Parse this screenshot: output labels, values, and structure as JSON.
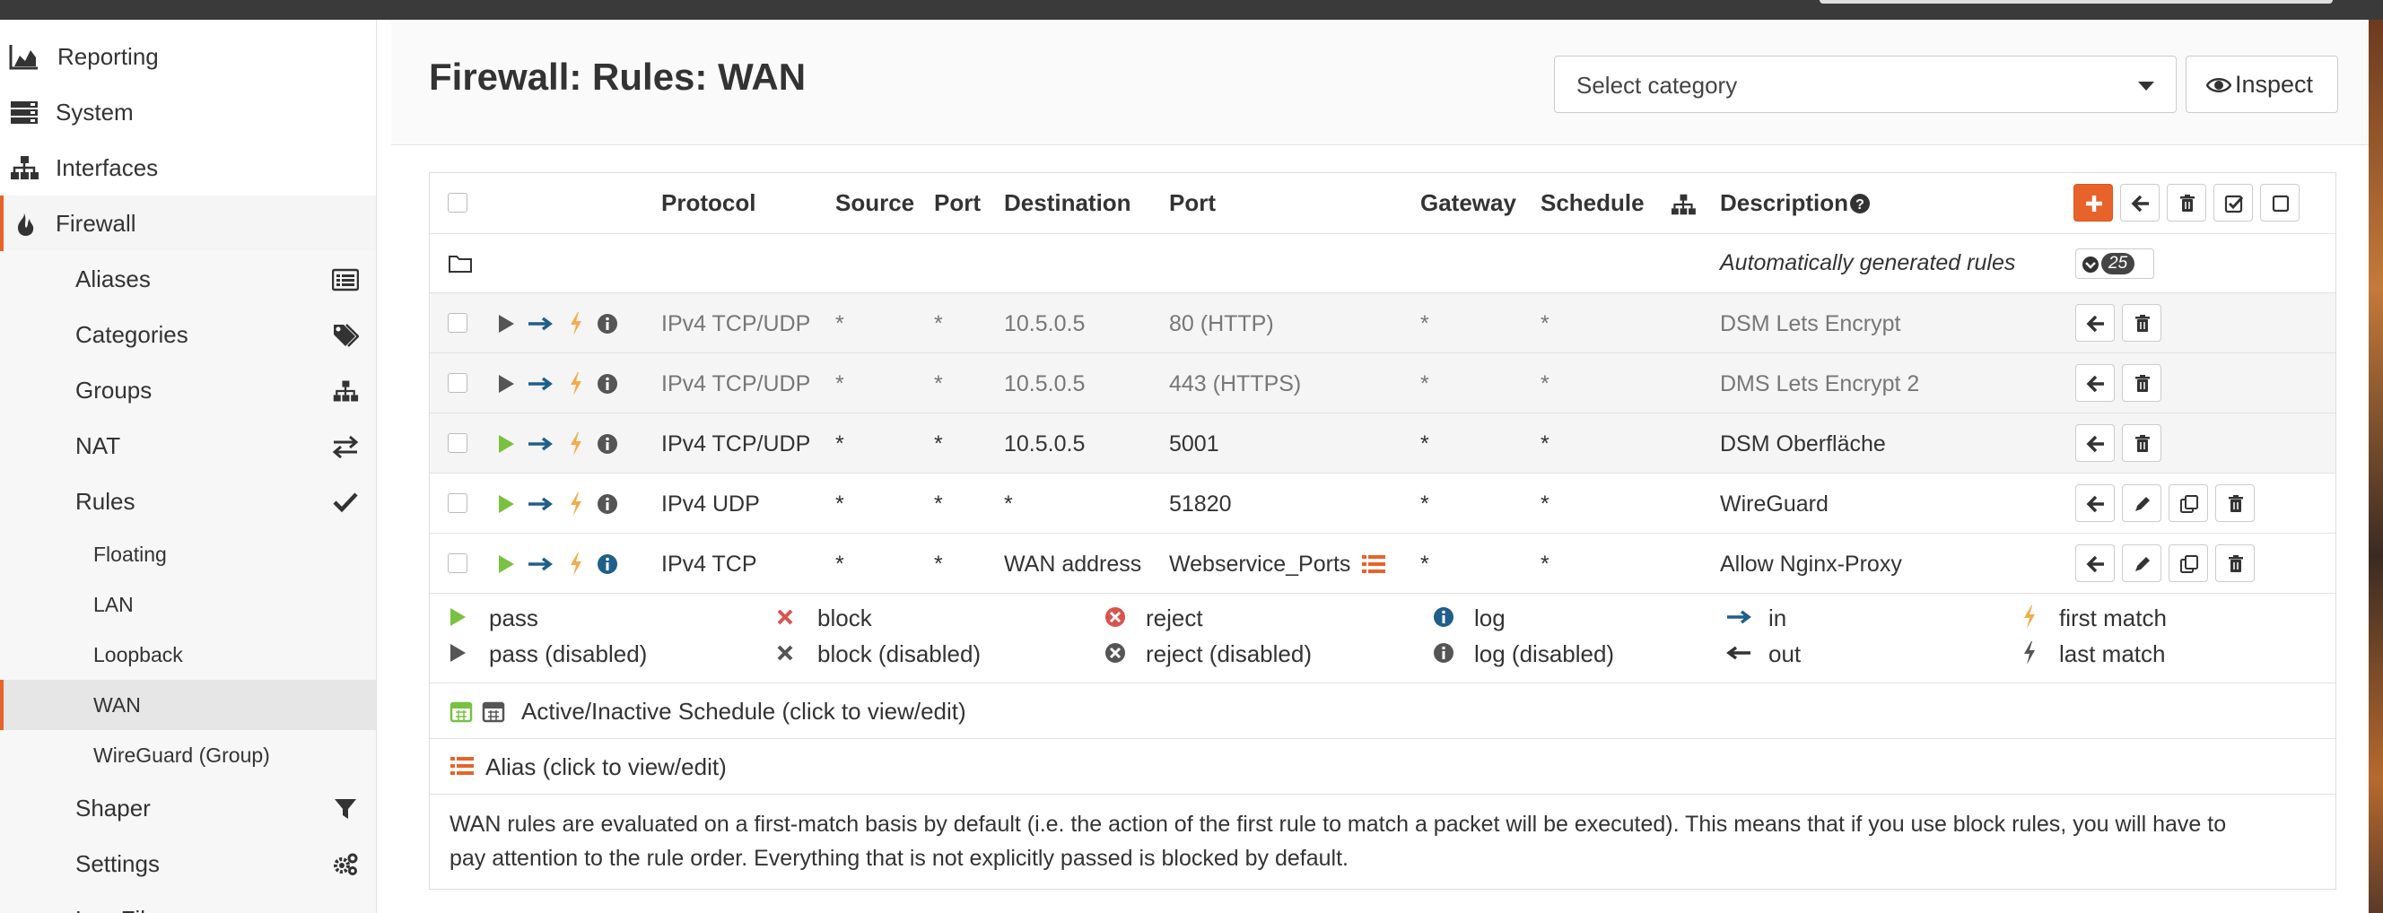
{
  "colors": {
    "accent": "#e8632a",
    "pass": "#7ac142",
    "block": "#d9534f",
    "info": "#1f5f8a",
    "arrow": "#1f5f8a",
    "bolt": "#f0ad4e"
  },
  "sidebar": {
    "items": [
      {
        "label": "Reporting",
        "icon": "chart-area-icon"
      },
      {
        "label": "System",
        "icon": "server-icon"
      },
      {
        "label": "Interfaces",
        "icon": "sitemap-icon"
      },
      {
        "label": "Firewall",
        "icon": "fire-icon"
      }
    ],
    "firewall_sub": [
      {
        "label": "Aliases",
        "icon": "list-alt-icon"
      },
      {
        "label": "Categories",
        "icon": "tags-icon"
      },
      {
        "label": "Groups",
        "icon": "sitemap-icon"
      },
      {
        "label": "NAT",
        "icon": "exchange-icon"
      },
      {
        "label": "Rules",
        "icon": "check-icon"
      }
    ],
    "rules_sub": [
      "Floating",
      "LAN",
      "Loopback",
      "WAN",
      "WireGuard (Group)"
    ],
    "after": [
      {
        "label": "Shaper",
        "icon": "filter-icon"
      },
      {
        "label": "Settings",
        "icon": "cogs-icon"
      }
    ],
    "cutoff_label": "Log Files"
  },
  "header": {
    "title": "Firewall: Rules: WAN",
    "category_select": "Select category",
    "inspect_label": "Inspect"
  },
  "table": {
    "columns": {
      "protocol": "Protocol",
      "source": "Source",
      "port": "Port",
      "destination": "Destination",
      "dport": "Port",
      "gateway": "Gateway",
      "schedule": "Schedule",
      "description": "Description"
    },
    "auto_rules": {
      "label": "Automatically generated rules",
      "count": "25"
    },
    "rows": [
      {
        "protocol": "IPv4 TCP/UDP",
        "source": "*",
        "port": "*",
        "destination": "10.5.0.5",
        "dport": "80 (HTTP)",
        "gateway": "*",
        "schedule": "*",
        "description": "DSM Lets Encrypt",
        "enabled": false
      },
      {
        "protocol": "IPv4 TCP/UDP",
        "source": "*",
        "port": "*",
        "destination": "10.5.0.5",
        "dport": "443 (HTTPS)",
        "gateway": "*",
        "schedule": "*",
        "description": "DMS Lets Encrypt 2",
        "enabled": false
      },
      {
        "protocol": "IPv4 TCP/UDP",
        "source": "*",
        "port": "*",
        "destination": "10.5.0.5",
        "dport": "5001",
        "gateway": "*",
        "schedule": "*",
        "description": "DSM Oberfläche",
        "enabled": true
      },
      {
        "protocol": "IPv4 UDP",
        "source": "*",
        "port": "*",
        "destination": "*",
        "dport": "51820",
        "gateway": "*",
        "schedule": "*",
        "description": "WireGuard",
        "enabled": true
      },
      {
        "protocol": "IPv4 TCP",
        "source": "*",
        "port": "*",
        "destination": "WAN address",
        "dport": "Webservice_Ports",
        "gateway": "*",
        "schedule": "*",
        "description": "Allow Nginx-Proxy",
        "enabled": true
      }
    ]
  },
  "legend": {
    "row1": [
      "pass",
      "block",
      "reject",
      "log",
      "in",
      "first match"
    ],
    "row2": [
      "pass (disabled)",
      "block (disabled)",
      "reject (disabled)",
      "log (disabled)",
      "out",
      "last match"
    ],
    "schedule": "Active/Inactive Schedule (click to view/edit)",
    "alias": "Alias (click to view/edit)",
    "note": [
      "WAN rules are evaluated on a first-match basis by default (i.e. the action of the first rule to match a packet will be executed). This means that if you use block rules, you will have to",
      "pay attention to the rule order. Everything that is not explicitly passed is blocked by default."
    ]
  }
}
